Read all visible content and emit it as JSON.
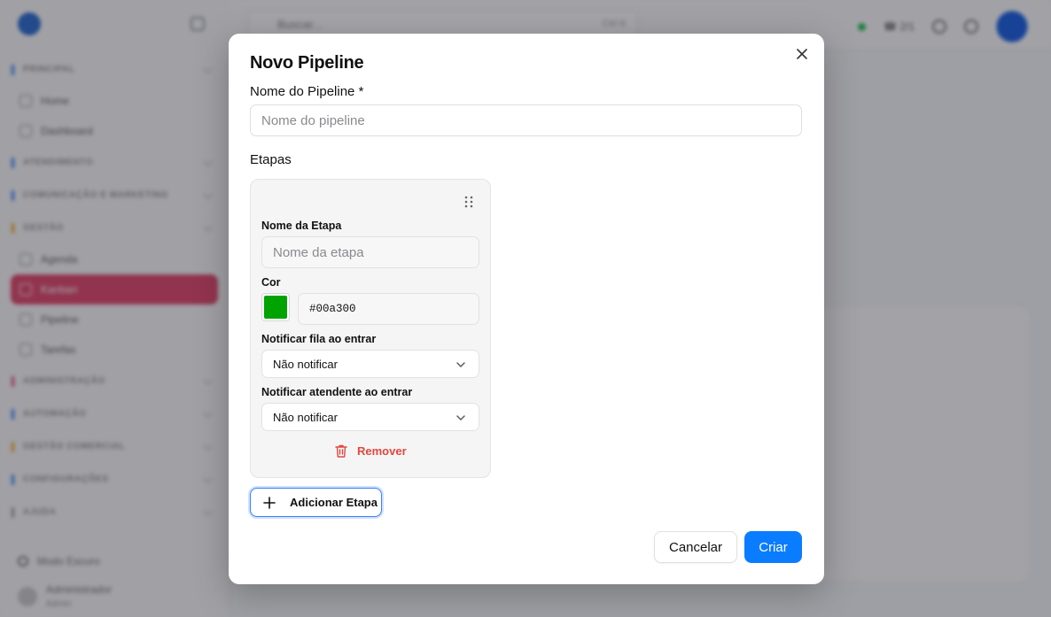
{
  "background": {
    "sidebar_items": [
      {
        "kind": "section",
        "label": "PRINCIPAL",
        "accent": "#3b82f6"
      },
      {
        "kind": "item",
        "label": "Home"
      },
      {
        "kind": "item",
        "label": "Dashboard"
      },
      {
        "kind": "section",
        "label": "ATENDIMENTO",
        "accent": "#3b82f6"
      },
      {
        "kind": "section",
        "label": "COMUNICAÇÃO E MARKETING",
        "accent": "#3b82f6"
      },
      {
        "kind": "section",
        "label": "GESTÃO",
        "accent": "#f5a623"
      },
      {
        "kind": "item",
        "label": "Agenda"
      },
      {
        "kind": "item",
        "label": "Kanban",
        "active": true
      },
      {
        "kind": "item",
        "label": "Pipeline"
      },
      {
        "kind": "item",
        "label": "Tarefas"
      },
      {
        "kind": "section",
        "label": "ADMINISTRAÇÃO",
        "accent": "#e04a6e"
      },
      {
        "kind": "section",
        "label": "AUTOMAÇÃO",
        "accent": "#3b82f6"
      },
      {
        "kind": "section",
        "label": "GESTÃO COMERCIAL",
        "accent": "#f5a623"
      },
      {
        "kind": "section",
        "label": "CONFIGURAÇÕES",
        "accent": "#3b82f6"
      },
      {
        "kind": "section",
        "label": "AJUDA",
        "accent": "#999999"
      }
    ],
    "search_placeholder": "Buscar...",
    "search_shortcut": "Ctrl K",
    "status_count": "2/1",
    "footer_mode": "Modo Escuro",
    "footer_user": "Administrador",
    "footer_role": "Admin"
  },
  "modal": {
    "title": "Novo Pipeline",
    "pipeline_name_label": "Nome do Pipeline *",
    "pipeline_name_placeholder": "Nome do pipeline",
    "pipeline_name_value": "",
    "stages_label": "Etapas",
    "stage": {
      "name_label": "Nome da Etapa",
      "name_placeholder": "Nome da etapa",
      "color_label": "Cor",
      "color_value": "#00a300",
      "notify_queue_label": "Notificar fila ao entrar",
      "notify_queue_value": "Não notificar",
      "notify_agent_label": "Notificar atendente ao entrar",
      "notify_agent_value": "Não notificar",
      "remove_label": "Remover"
    },
    "add_stage_label": "Adicionar Etapa",
    "cancel_label": "Cancelar",
    "create_label": "Criar"
  },
  "colors": {
    "primary": "#0a7cff",
    "danger": "#e0483f",
    "active_nav": "#e04a6e"
  },
  "icons": [
    "close-icon",
    "drag-handle-icon",
    "chevron-down-icon",
    "trash-icon",
    "plus-icon",
    "search-icon",
    "moon-icon",
    "bell-icon",
    "phone-icon"
  ]
}
